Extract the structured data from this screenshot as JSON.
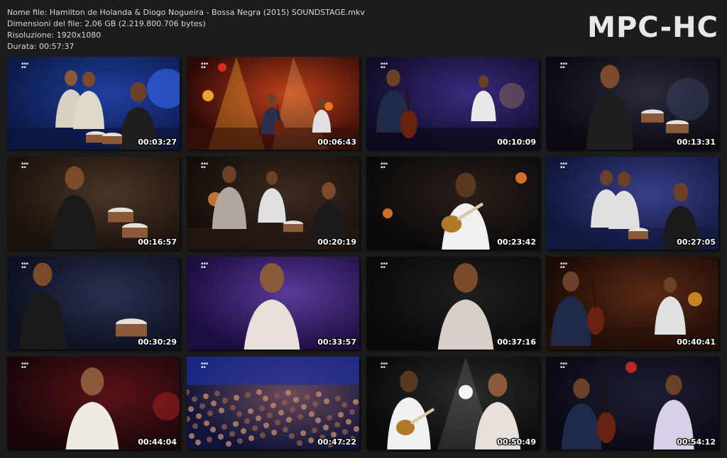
{
  "header": {
    "file_name": "Nome file: Hamilton de Holanda & Diogo Nogueira - Bossa Negra (2015) SOUNDSTAGE.mkv",
    "file_size": "Dimensioni del file: 2,06 GB (2.219.800.706 bytes)",
    "resolution": "Risoluzione: 1920x1080",
    "duration": "Durata: 00:57:37"
  },
  "logo": "MPC-HC",
  "thumbnails": [
    {
      "time": "00:03:27",
      "scene": "blue-stage-band",
      "colors": [
        "#0d1a4a",
        "#1f3fa0"
      ]
    },
    {
      "time": "00:06:43",
      "scene": "spotlights-stage",
      "colors": [
        "#2a0806",
        "#c0401a"
      ]
    },
    {
      "time": "00:10:09",
      "scene": "bass-stage",
      "colors": [
        "#120c28",
        "#3a2a80"
      ]
    },
    {
      "time": "00:13:31",
      "scene": "percussionist-dark",
      "colors": [
        "#0a0a12",
        "#2a2a3a"
      ]
    },
    {
      "time": "00:16:57",
      "scene": "percussionist-brown",
      "colors": [
        "#1a120c",
        "#4a3526"
      ]
    },
    {
      "time": "00:20:19",
      "scene": "stage-singer-drums",
      "colors": [
        "#140e0a",
        "#3c2a20"
      ]
    },
    {
      "time": "00:23:42",
      "scene": "mandolin-closeup",
      "colors": [
        "#0a0a0a",
        "#2a1e18"
      ]
    },
    {
      "time": "00:27:05",
      "scene": "stage-blue-keyboard",
      "colors": [
        "#10163a",
        "#3a3f8a"
      ]
    },
    {
      "time": "00:30:29",
      "scene": "percussion-closeup",
      "colors": [
        "#0c1020",
        "#2a3050"
      ]
    },
    {
      "time": "00:33:57",
      "scene": "singer-purple",
      "colors": [
        "#1c0e40",
        "#5a3a9a"
      ]
    },
    {
      "time": "00:37:16",
      "scene": "singer-dark",
      "colors": [
        "#0a0a0a",
        "#1e1e1e"
      ]
    },
    {
      "time": "00:40:41",
      "scene": "bass-guitar-duo",
      "colors": [
        "#1a0a06",
        "#5a2a14"
      ]
    },
    {
      "time": "00:44:04",
      "scene": "singer-red",
      "colors": [
        "#1a0608",
        "#5a1218"
      ]
    },
    {
      "time": "00:47:22",
      "scene": "audience-wide",
      "colors": [
        "#10143a",
        "#6a4a5a"
      ]
    },
    {
      "time": "00:50:49",
      "scene": "duet-spotlight",
      "colors": [
        "#0a0a0a",
        "#2a2a2a"
      ]
    },
    {
      "time": "00:54:12",
      "scene": "bass-guitar-night",
      "colors": [
        "#0a0a14",
        "#1e1e34"
      ]
    }
  ]
}
